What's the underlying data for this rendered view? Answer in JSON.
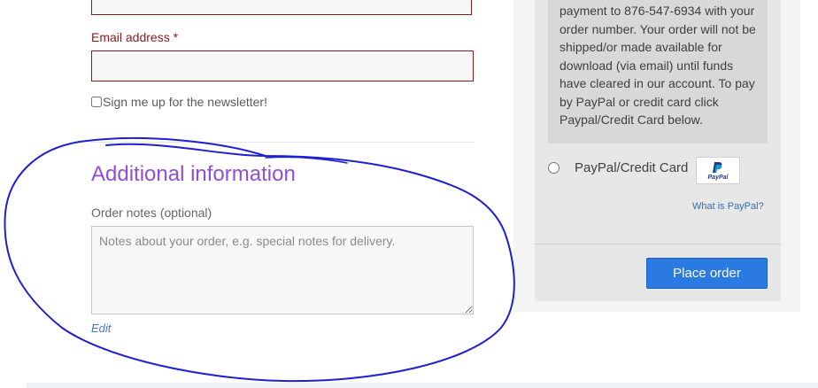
{
  "billing": {
    "email_label": "Email address",
    "required_mark": "*",
    "email_value": "",
    "newsletter_label": "Sign me up for the newsletter!"
  },
  "additional": {
    "title": "Additional information",
    "order_notes_label": "Order notes (optional)",
    "order_notes_placeholder": "Notes about your order, e.g. special notes for delivery.",
    "edit_link": "Edit"
  },
  "payment": {
    "description": "payment to 876-547-6934 with your order number. Your order will not be shipped/or made available for download (via email) until funds have cleared in our account. To pay by PayPal or credit card click Paypal/Credit Card below.",
    "paypal_label": "PayPal/Credit Card",
    "paypal_badge_text": "PayPal",
    "what_is_paypal": "What is PayPal?",
    "place_order_label": "Place order"
  },
  "colors": {
    "error_border": "#8b1a1a",
    "section_title": "#8f4fd6",
    "primary_button": "#2a7ae2",
    "annotation_ink": "#1d1fd1"
  }
}
